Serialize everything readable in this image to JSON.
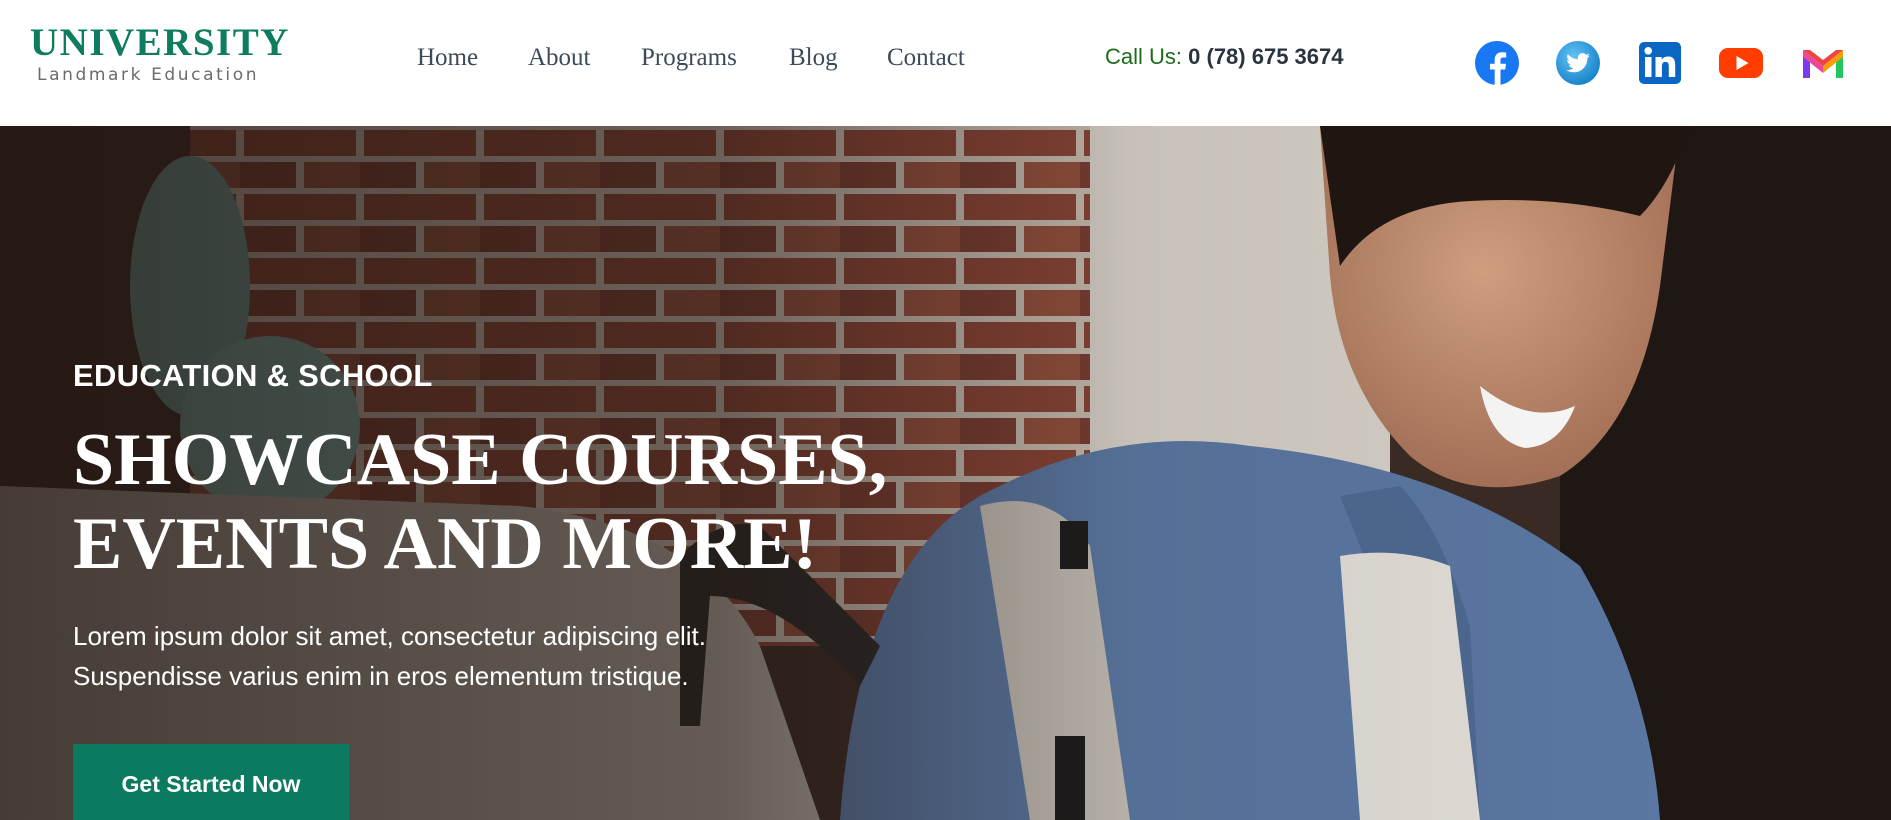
{
  "logo": {
    "title": "UNIVERSITY",
    "subtitle": "Landmark Education"
  },
  "nav": {
    "items": [
      {
        "label": "Home"
      },
      {
        "label": "About"
      },
      {
        "label": "Programs"
      },
      {
        "label": "Blog"
      },
      {
        "label": "Contact"
      }
    ]
  },
  "contact": {
    "label": "Call Us:",
    "phone": "0 (78) 675 3674"
  },
  "socials": [
    {
      "name": "facebook-icon",
      "color": "#1877f2"
    },
    {
      "name": "twitter-icon",
      "color": "#1da1f2"
    },
    {
      "name": "linkedin-icon",
      "color": "#0a66c2"
    },
    {
      "name": "youtube-icon",
      "color": "#ff3d00"
    },
    {
      "name": "gmail-icon",
      "color": "#ea4335"
    }
  ],
  "hero": {
    "eyebrow": "EDUCATION & SCHOOL",
    "headline_1": "SHOWCASE COURSES,",
    "headline_2": "EVENTS AND MORE!",
    "desc_1": "Lorem ipsum dolor sit amet, consectetur adipiscing elit.",
    "desc_2": "Suspendisse varius enim in eros elementum tristique.",
    "cta_label": "Get Started Now"
  },
  "colors": {
    "brand": "#0d7c5f",
    "cta": "#0b7a5e"
  }
}
